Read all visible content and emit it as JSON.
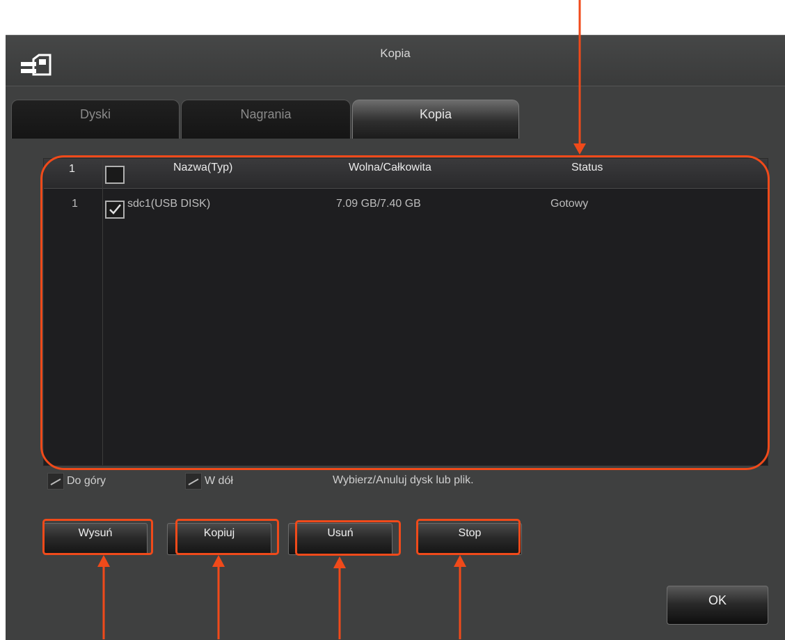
{
  "window": {
    "title": "Kopia",
    "icon": "backup-device-icon"
  },
  "tabs": [
    {
      "label": "Dyski",
      "active": false
    },
    {
      "label": "Nagrania",
      "active": false
    },
    {
      "label": "Kopia",
      "active": true
    }
  ],
  "table": {
    "headers": {
      "index": "1",
      "name": "Nazwa(Typ)",
      "space": "Wolna/Całkowita",
      "status": "Status"
    },
    "rows": [
      {
        "index": "1",
        "checked": true,
        "name": "sdc1(USB DISK)",
        "space": "7.09 GB/7.40 GB",
        "status": "Gotowy"
      }
    ]
  },
  "nav": {
    "up_label": "Do góry",
    "down_label": "W dół"
  },
  "hint": "Wybierz/Anuluj dysk lub plik.",
  "buttons": {
    "eject": "Wysuń",
    "copy": "Kopiuj",
    "delete": "Usuń",
    "stop": "Stop",
    "ok": "OK"
  },
  "colors": {
    "annotation": "#f04a1a",
    "window_bg": "#3f4040",
    "table_bg": "#1e1e20"
  }
}
